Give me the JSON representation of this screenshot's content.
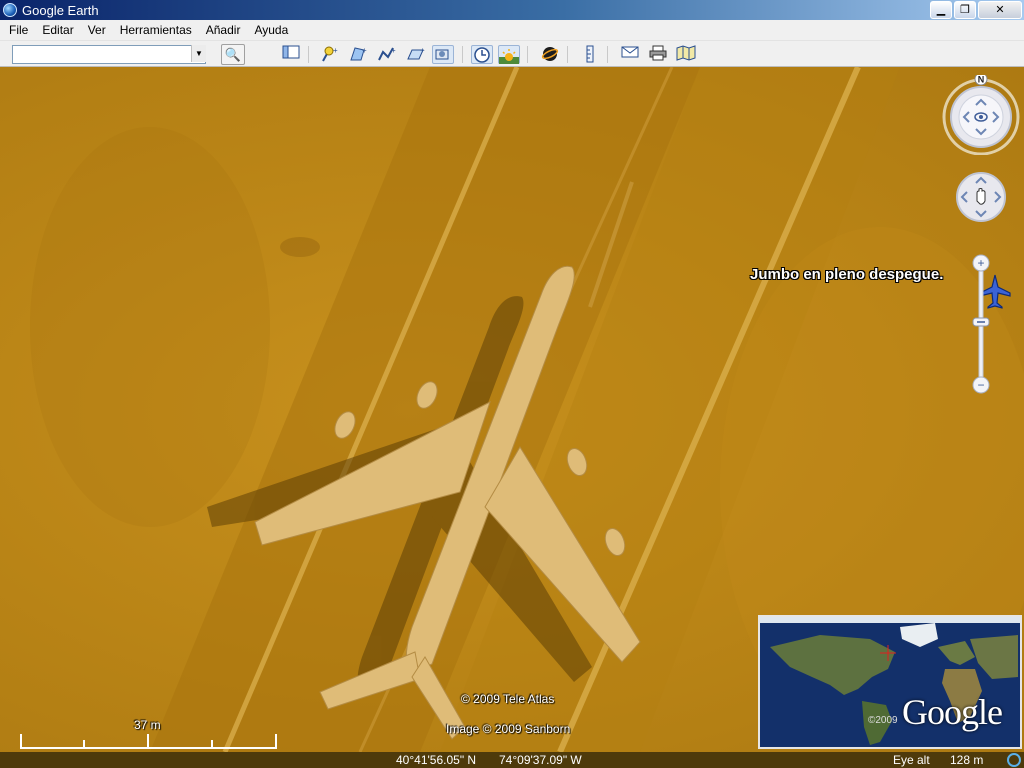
{
  "window": {
    "title": "Google Earth"
  },
  "window_buttons": {
    "minimize": "▁",
    "maximize": "❐",
    "close": "✕"
  },
  "menu": [
    "File",
    "Editar",
    "Ver",
    "Herramientas",
    "Añadir",
    "Ayuda"
  ],
  "toolbar": {
    "search": {
      "value": "",
      "placeholder": ""
    },
    "icons": [
      "search-icon",
      "sidebar-icon",
      "placemark-icon",
      "polygon-icon",
      "path-icon",
      "image-overlay-icon",
      "record-tour-icon",
      "historical-imagery-icon",
      "sunlight-icon",
      "planets-icon",
      "ruler-icon",
      "email-icon",
      "print-icon",
      "maps-icon"
    ]
  },
  "map": {
    "placemark_label": "Jumbo en pleno despegue.",
    "attribution_1": "© 2009 Tele Atlas",
    "attribution_2": "Image © 2009 Sanborn",
    "scale_label": "37 m",
    "north_label": "N",
    "zoom_plus": "+",
    "zoom_minus": "−"
  },
  "overview": {
    "copyright": "©2009",
    "logo": "Google"
  },
  "status": {
    "latitude": "40°41'56.05\" N",
    "longitude": "74°09'37.09\" W",
    "eye_alt_label": "Eye alt",
    "eye_alt_value": "128 m"
  },
  "colors": {
    "terrain": "#b98416",
    "title_bar": "#0a246a",
    "status_bar": "#4e3a0b"
  }
}
